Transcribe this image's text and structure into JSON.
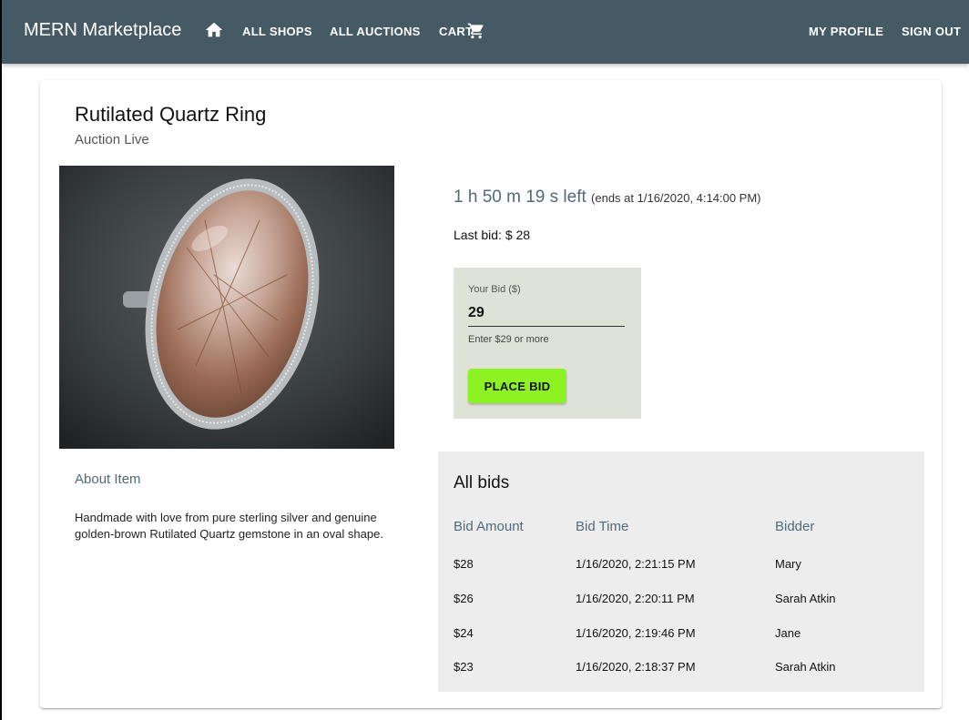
{
  "appbar": {
    "brand": "MERN Marketplace",
    "nav_all_shops": "ALL SHOPS",
    "nav_all_auctions": "ALL AUCTIONS",
    "nav_cart": "CART",
    "nav_my_profile": "MY PROFILE",
    "nav_sign_out": "SIGN OUT"
  },
  "auction": {
    "title": "Rutilated Quartz Ring",
    "status": "Auction Live",
    "time_left": "1 h 50 m 19 s left",
    "ends_at": "(ends at 1/16/2020, 4:14:00 PM)",
    "last_bid": "Last bid: $ 28",
    "about_heading": "About Item",
    "about_text": "Handmade with love from pure sterling silver and genuine golden-brown Rutilated Quartz gemstone in an oval shape."
  },
  "bid_form": {
    "label": "Your Bid ($)",
    "value": "29",
    "helper": "Enter $29 or more",
    "button": "PLACE BID"
  },
  "bids": {
    "title": "All bids",
    "headers": [
      "Bid Amount",
      "Bid Time",
      "Bidder"
    ],
    "rows": [
      {
        "amount": "$28",
        "time": "1/16/2020, 2:21:15 PM",
        "bidder": "Mary"
      },
      {
        "amount": "$26",
        "time": "1/16/2020, 2:20:11 PM",
        "bidder": "Sarah Atkin"
      },
      {
        "amount": "$24",
        "time": "1/16/2020, 2:19:46 PM",
        "bidder": "Jane"
      },
      {
        "amount": "$23",
        "time": "1/16/2020, 2:18:37 PM",
        "bidder": "Sarah Atkin"
      }
    ]
  },
  "colors": {
    "appbar": "#455a64",
    "accent_text": "#4f6b79",
    "bid_button": "#8cf221",
    "bid_box": "#dfe3d7",
    "bids_panel": "#ededed"
  },
  "icons": {
    "home": "home-icon",
    "cart": "shopping-cart-icon"
  }
}
